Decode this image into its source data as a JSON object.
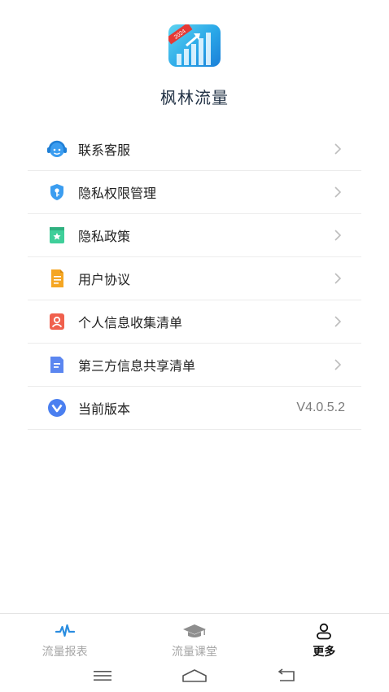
{
  "app": {
    "name": "枫林流量",
    "icon_badge": "2024"
  },
  "menu": [
    {
      "label": "联系客服",
      "icon": "headset-icon",
      "color": "#3b9df0"
    },
    {
      "label": "隐私权限管理",
      "icon": "shield-key-icon",
      "color": "#3b9df0"
    },
    {
      "label": "隐私政策",
      "icon": "bookmark-star-icon",
      "color": "#3fcf9a"
    },
    {
      "label": "用户协议",
      "icon": "document-icon",
      "color": "#f5a623"
    },
    {
      "label": "个人信息收集清单",
      "icon": "user-card-icon",
      "color": "#f0604d"
    },
    {
      "label": "第三方信息共享清单",
      "icon": "file-list-icon",
      "color": "#5b86f0"
    },
    {
      "label": "当前版本",
      "icon": "version-icon",
      "color": "#4a7ff0",
      "value": "V4.0.5.2"
    }
  ],
  "tabs": [
    {
      "label": "流量报表",
      "icon": "pulse-icon",
      "active": false
    },
    {
      "label": "流量课堂",
      "icon": "graduation-cap-icon",
      "active": false
    },
    {
      "label": "更多",
      "icon": "user-icon",
      "active": true
    }
  ]
}
